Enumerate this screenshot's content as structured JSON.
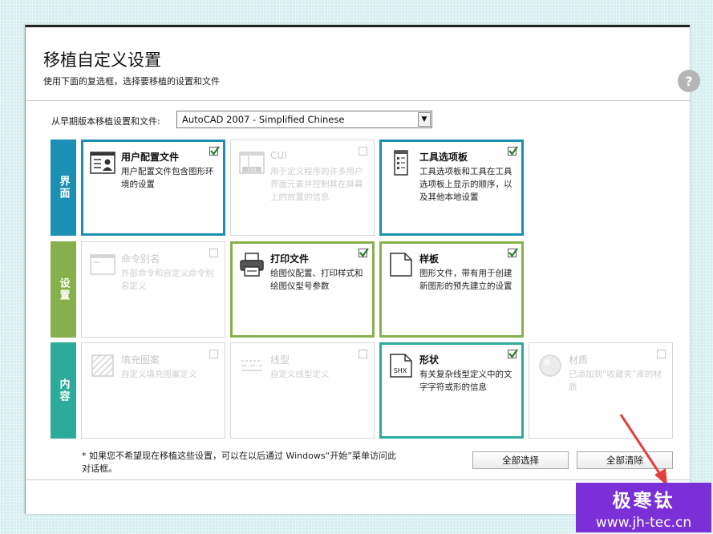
{
  "dialog": {
    "title": "移植自定义设置",
    "subtitle": "使用下面的复选框，选择要移植的设置和文件",
    "help_label": "?",
    "from_label": "从早期版本移植设置和文件:",
    "version_select": "AutoCAD 2007 - Simplified Chinese",
    "categories": [
      {
        "label": "界面",
        "color": "#1b8fb4"
      },
      {
        "label": "设置",
        "color": "#86b04b"
      },
      {
        "label": "内容",
        "color": "#2dab9a"
      }
    ],
    "cards": {
      "user_profile": {
        "title": "用户配置文件",
        "desc": "用户配置文件包含图形环境的设置",
        "checked": true
      },
      "cui": {
        "title": "CUI",
        "desc": "用于定义程序的许多用户界面元素并控制其在屏幕上的放置的信息",
        "checked": false
      },
      "tool_palettes": {
        "title": "工具选项板",
        "desc": "工具选项板和工具在工具选项板上显示的顺序，以及其他本地设置",
        "checked": true
      },
      "command_alias": {
        "title": "命令别名",
        "desc": "外部命令和自定义命令别名定义",
        "checked": false
      },
      "plot_files": {
        "title": "打印文件",
        "desc": "绘图仪配置、打印样式和绘图仪型号参数",
        "checked": true
      },
      "templates": {
        "title": "样板",
        "desc": "图形文件，带有用于创建新图形的预先建立的设置",
        "checked": true
      },
      "hatch_pattern": {
        "title": "填充图案",
        "desc": "自定义填充图案定义",
        "checked": false
      },
      "linetype": {
        "title": "线型",
        "desc": "自定义线型定义",
        "checked": false
      },
      "shapes": {
        "title": "形状",
        "desc": "有关复杂线型定义中的文字字符或形的信息",
        "checked": true,
        "icon_text": "SHX"
      },
      "materials": {
        "title": "材质",
        "desc": "已添加到“收藏夹”库的材质",
        "checked": false
      }
    },
    "footnote": "* 如果您不希望现在移植这些设置，可以在以后通过 Windows“开始”菜单访问此对话框。",
    "select_all_button": "全部选择",
    "clear_all_button": "全部清除",
    "cui_icon_text": "CUI"
  },
  "watermark": {
    "name": "极寒钛",
    "url": "www.jh-tec.cn"
  },
  "colors": {
    "interface": "#1b8fb4",
    "settings": "#86b04b",
    "content": "#2dab9a",
    "watermark_bg": "#7b2fd6",
    "arrow": "#e5403c"
  }
}
